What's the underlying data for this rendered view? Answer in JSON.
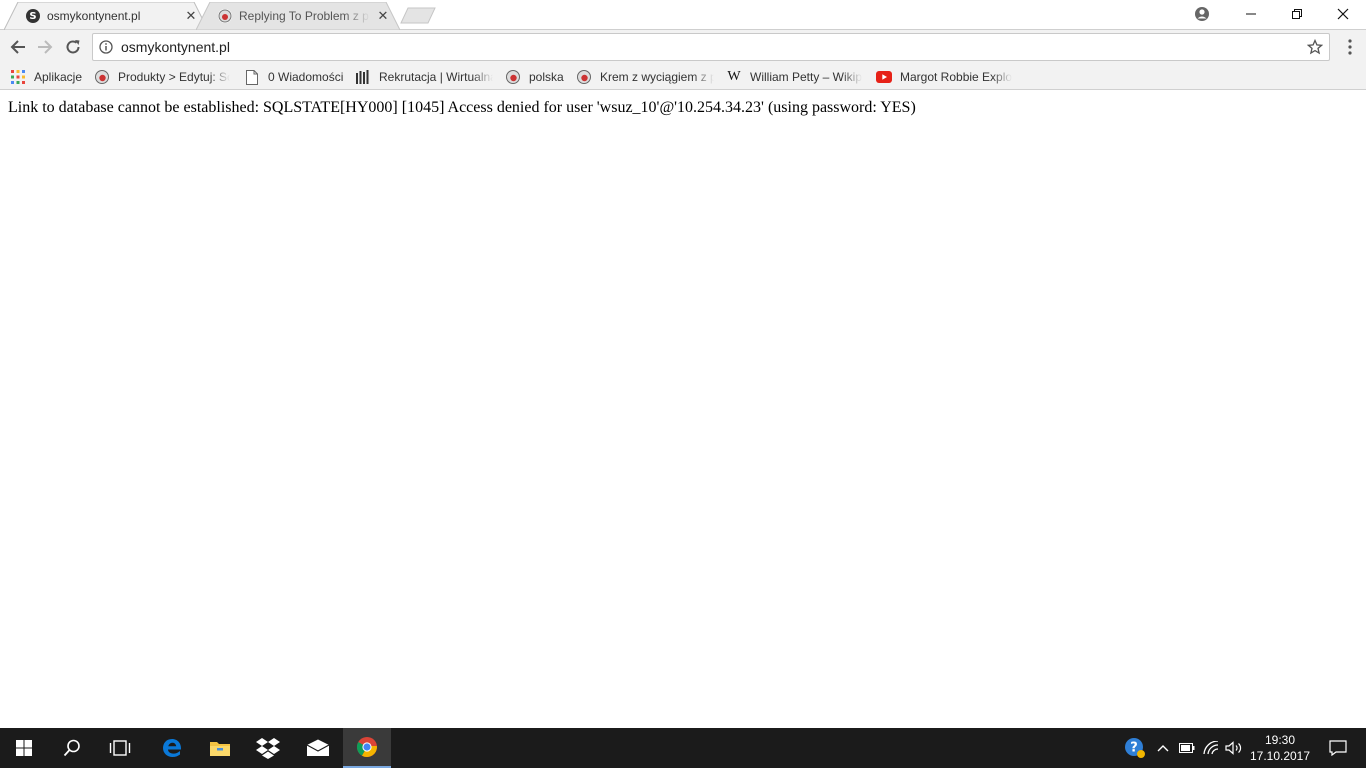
{
  "browser": {
    "tabs": [
      {
        "title": "osmykontynent.pl",
        "active": true
      },
      {
        "title": "Replying To Problem z problem",
        "active": false
      }
    ],
    "address": "osmykontynent.pl",
    "bookmarks": [
      {
        "label": "Aplikacje",
        "icon": "apps-grid-icon"
      },
      {
        "label": "Produkty > Edytuj: Sc",
        "icon": "site-favicon"
      },
      {
        "label": "0 Wiadomości",
        "icon": "page-icon"
      },
      {
        "label": "Rekrutacja | Wirtualna",
        "icon": "site-favicon"
      },
      {
        "label": "polska",
        "icon": "site-favicon"
      },
      {
        "label": "Krem z wyciągiem z p",
        "icon": "site-favicon"
      },
      {
        "label": "William Petty – Wikip",
        "icon": "wikipedia-icon"
      },
      {
        "label": "Margot Robbie Explo",
        "icon": "youtube-icon"
      }
    ]
  },
  "page": {
    "message": "Link to database cannot be established: SQLSTATE[HY000] [1045] Access denied for user 'wsuz_10'@'10.254.34.23' (using password: YES)"
  },
  "taskbar": {
    "time": "19:30",
    "date": "17.10.2017",
    "pinned": [
      "windows-start-icon",
      "search-icon",
      "task-view-icon",
      "edge-icon",
      "file-explorer-icon",
      "dropbox-icon",
      "mail-icon",
      "chrome-icon"
    ]
  },
  "colors": {
    "taskbar_bg": "#1b1b1b",
    "toolbar_bg": "#f2f2f2",
    "youtube_red": "#e62117",
    "edge_blue": "#0a78d7"
  }
}
